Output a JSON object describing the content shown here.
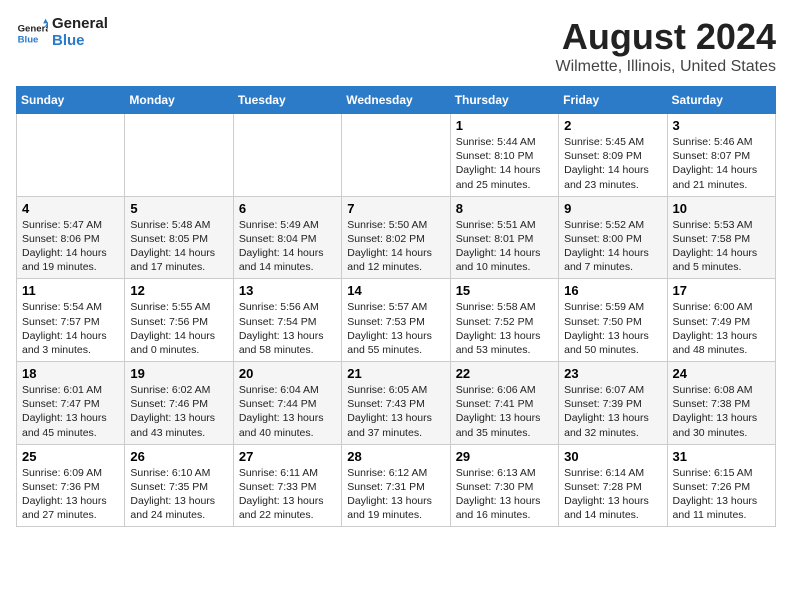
{
  "header": {
    "logo_general": "General",
    "logo_blue": "Blue",
    "title": "August 2024",
    "subtitle": "Wilmette, Illinois, United States"
  },
  "days_of_week": [
    "Sunday",
    "Monday",
    "Tuesday",
    "Wednesday",
    "Thursday",
    "Friday",
    "Saturday"
  ],
  "weeks": [
    [
      {
        "num": "",
        "info": ""
      },
      {
        "num": "",
        "info": ""
      },
      {
        "num": "",
        "info": ""
      },
      {
        "num": "",
        "info": ""
      },
      {
        "num": "1",
        "info": "Sunrise: 5:44 AM\nSunset: 8:10 PM\nDaylight: 14 hours and 25 minutes."
      },
      {
        "num": "2",
        "info": "Sunrise: 5:45 AM\nSunset: 8:09 PM\nDaylight: 14 hours and 23 minutes."
      },
      {
        "num": "3",
        "info": "Sunrise: 5:46 AM\nSunset: 8:07 PM\nDaylight: 14 hours and 21 minutes."
      }
    ],
    [
      {
        "num": "4",
        "info": "Sunrise: 5:47 AM\nSunset: 8:06 PM\nDaylight: 14 hours and 19 minutes."
      },
      {
        "num": "5",
        "info": "Sunrise: 5:48 AM\nSunset: 8:05 PM\nDaylight: 14 hours and 17 minutes."
      },
      {
        "num": "6",
        "info": "Sunrise: 5:49 AM\nSunset: 8:04 PM\nDaylight: 14 hours and 14 minutes."
      },
      {
        "num": "7",
        "info": "Sunrise: 5:50 AM\nSunset: 8:02 PM\nDaylight: 14 hours and 12 minutes."
      },
      {
        "num": "8",
        "info": "Sunrise: 5:51 AM\nSunset: 8:01 PM\nDaylight: 14 hours and 10 minutes."
      },
      {
        "num": "9",
        "info": "Sunrise: 5:52 AM\nSunset: 8:00 PM\nDaylight: 14 hours and 7 minutes."
      },
      {
        "num": "10",
        "info": "Sunrise: 5:53 AM\nSunset: 7:58 PM\nDaylight: 14 hours and 5 minutes."
      }
    ],
    [
      {
        "num": "11",
        "info": "Sunrise: 5:54 AM\nSunset: 7:57 PM\nDaylight: 14 hours and 3 minutes."
      },
      {
        "num": "12",
        "info": "Sunrise: 5:55 AM\nSunset: 7:56 PM\nDaylight: 14 hours and 0 minutes."
      },
      {
        "num": "13",
        "info": "Sunrise: 5:56 AM\nSunset: 7:54 PM\nDaylight: 13 hours and 58 minutes."
      },
      {
        "num": "14",
        "info": "Sunrise: 5:57 AM\nSunset: 7:53 PM\nDaylight: 13 hours and 55 minutes."
      },
      {
        "num": "15",
        "info": "Sunrise: 5:58 AM\nSunset: 7:52 PM\nDaylight: 13 hours and 53 minutes."
      },
      {
        "num": "16",
        "info": "Sunrise: 5:59 AM\nSunset: 7:50 PM\nDaylight: 13 hours and 50 minutes."
      },
      {
        "num": "17",
        "info": "Sunrise: 6:00 AM\nSunset: 7:49 PM\nDaylight: 13 hours and 48 minutes."
      }
    ],
    [
      {
        "num": "18",
        "info": "Sunrise: 6:01 AM\nSunset: 7:47 PM\nDaylight: 13 hours and 45 minutes."
      },
      {
        "num": "19",
        "info": "Sunrise: 6:02 AM\nSunset: 7:46 PM\nDaylight: 13 hours and 43 minutes."
      },
      {
        "num": "20",
        "info": "Sunrise: 6:04 AM\nSunset: 7:44 PM\nDaylight: 13 hours and 40 minutes."
      },
      {
        "num": "21",
        "info": "Sunrise: 6:05 AM\nSunset: 7:43 PM\nDaylight: 13 hours and 37 minutes."
      },
      {
        "num": "22",
        "info": "Sunrise: 6:06 AM\nSunset: 7:41 PM\nDaylight: 13 hours and 35 minutes."
      },
      {
        "num": "23",
        "info": "Sunrise: 6:07 AM\nSunset: 7:39 PM\nDaylight: 13 hours and 32 minutes."
      },
      {
        "num": "24",
        "info": "Sunrise: 6:08 AM\nSunset: 7:38 PM\nDaylight: 13 hours and 30 minutes."
      }
    ],
    [
      {
        "num": "25",
        "info": "Sunrise: 6:09 AM\nSunset: 7:36 PM\nDaylight: 13 hours and 27 minutes."
      },
      {
        "num": "26",
        "info": "Sunrise: 6:10 AM\nSunset: 7:35 PM\nDaylight: 13 hours and 24 minutes."
      },
      {
        "num": "27",
        "info": "Sunrise: 6:11 AM\nSunset: 7:33 PM\nDaylight: 13 hours and 22 minutes."
      },
      {
        "num": "28",
        "info": "Sunrise: 6:12 AM\nSunset: 7:31 PM\nDaylight: 13 hours and 19 minutes."
      },
      {
        "num": "29",
        "info": "Sunrise: 6:13 AM\nSunset: 7:30 PM\nDaylight: 13 hours and 16 minutes."
      },
      {
        "num": "30",
        "info": "Sunrise: 6:14 AM\nSunset: 7:28 PM\nDaylight: 13 hours and 14 minutes."
      },
      {
        "num": "31",
        "info": "Sunrise: 6:15 AM\nSunset: 7:26 PM\nDaylight: 13 hours and 11 minutes."
      }
    ]
  ]
}
